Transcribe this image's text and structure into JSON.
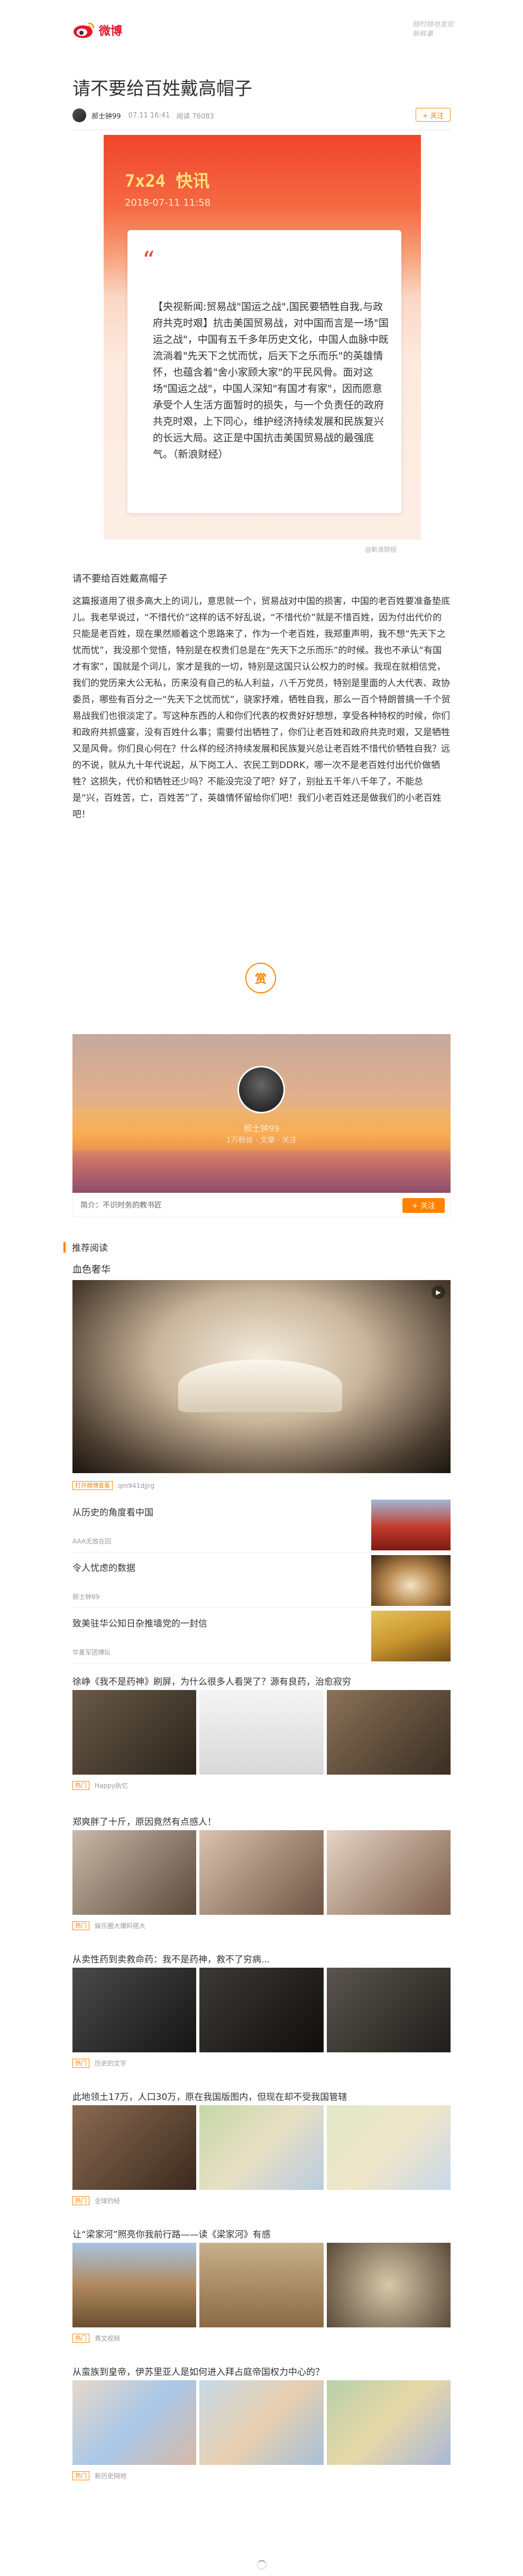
{
  "header": {
    "logo_text": "微博",
    "slogan": "随时随地发现新鲜事"
  },
  "article": {
    "title": "请不要给百姓戴高帽子",
    "author": "郝士钟99",
    "datetime": "07.11 16:41",
    "reads": "阅读 76083",
    "follow_label": "+ 关注"
  },
  "news_card": {
    "heading": "7x24 快讯",
    "date": "2018-07-11 11:58",
    "quote": "“",
    "body": "【央视新闻:贸易战\"国运之战\",国民要牺牲自我,与政府共克时艰】抗击美国贸易战，对中国而言是一场\"国运之战\"，中国有五千多年历史文化，中国人血脉中既流淌着\"先天下之忧而忧，后天下之乐而乐\"的英雄情怀，也蕴含着\"舍小家顾大家\"的平民风骨。面对这场\"国运之战\"，中国人深知\"有国才有家\"，因而愿意承受个人生活方面暂时的损失，与一个负责任的政府共克时艰，上下同心，维护经济持续发展和民族复兴的长远大局。这正是中国抗击美国贸易战的最强底气。（新浪财经）",
    "watermark": "@新浪财经"
  },
  "content": {
    "subtitle": "请不要给百姓戴高帽子",
    "body": "这篇报道用了很多高大上的词儿，意思就一个，贸易战对中国的损害，中国的老百姓要准备垫底儿。我老早说过，“不惜代价”这样的话不好乱说，“不惜代价”就是不惜百姓，因为付出代价的只能是老百姓，现在果然顺着这个思路来了，作为一个老百姓，我郑重声明，我不想“先天下之忧而忧”，我没那个觉悟，特别是在权贵们总是在“先天下之乐而乐”的时候。我也不承认“有国才有家”，国就是个词儿，家才是我的一切，特别是这国只认公权力的时候。我现在就相信党，我们的党历来大公无私，历来没有自己的私人利益，八千万党员，特别是里面的人大代表、政协委员，哪些有百分之一“先天下之忧而忧”，骁家抒难，牺牲自我，那么一百个特朗普搞一千个贸易战我们也很淡定了。写这种东西的人和你们代表的权贵好好想想，享受各种特权的时候，你们和政府共抓盛宴，没有百姓什么事；需要付出牺牲了，你们让老百姓和政府共克时艰，又是牺牲又是风骨。你们良心何在？什么样的经济持续发展和民族复兴总让老百姓不惜代价牺牲自我？远的不说，就从九十年代说起，从下岗工人、农民工到DDRK，哪一次不是老百姓付出代价做牺牲？这损失，代价和牺牲还少吗？不能没完没了吧？好了，别扯五千年八千年了，不能总是“兴，百姓苦，亡，百姓苦”了，英雄情怀留给你们吧！我们小老百姓还是做我们的小老百姓吧！",
    "reward_label": "赏"
  },
  "author_card": {
    "name": "郝士钟99",
    "stats": "1万粉丝 · 文章 · 关注",
    "intro": "简介：不识时务的教书匠",
    "follow_label": "+ 关注"
  },
  "recommend": {
    "heading": "推荐阅读",
    "featured": {
      "title": "血色奢华",
      "tag": "打开微博查看",
      "source": "qm941djjrg"
    },
    "list": [
      {
        "title": "从历史的角度看中国",
        "source": "AAA无放在回"
      },
      {
        "title": "令人忧虑的数据",
        "source": "郝士钟99"
      },
      {
        "title": "致美驻华公知日杂推墙党的一封信",
        "source": "华夏军团博坛"
      }
    ],
    "multi": [
      {
        "title": "徐峥《我不是药神》刷屏，为什么很多人看哭了？源有良药，治愈寂穷",
        "tag": "热门",
        "source": "Happy执忆"
      },
      {
        "title": "郑爽胖了十斤，原因竟然有点感人！",
        "tag": "热门",
        "source": "娱乐圈大爆料搭大"
      },
      {
        "title": "从卖性药到卖救命药：我不是药神，救不了穷病...",
        "tag": "热门",
        "source": "历史的文字"
      },
      {
        "title": "此地领土17万，人口30万，原在我国版图内，但现在却不受我国管辖",
        "tag": "热门",
        "source": "全球的经"
      },
      {
        "title": "让“梁家河”照亮你我前行路——读《梁家河》有感",
        "tag": "热门",
        "source": "青文视频"
      },
      {
        "title": "从蛮族到皇帝，伊苏里亚人是如何进入拜占庭帝国权力中心的？",
        "tag": "热门",
        "source": "新历史网地"
      }
    ]
  }
}
